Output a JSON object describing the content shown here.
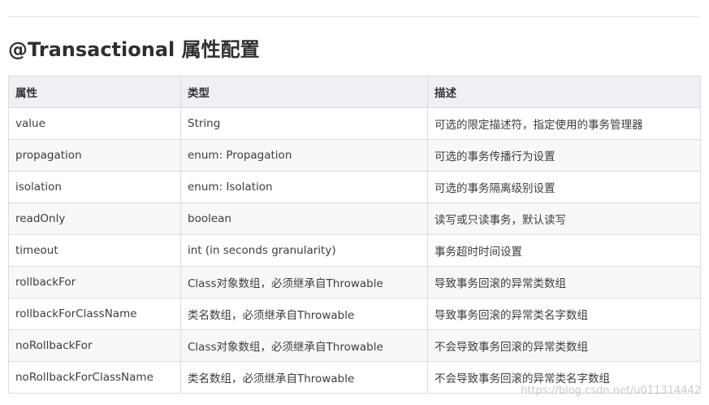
{
  "heading": "@Transactional 属性配置",
  "table": {
    "headers": [
      "属性",
      "类型",
      "描述"
    ],
    "rows": [
      [
        "value",
        "String",
        "可选的限定描述符，指定使用的事务管理器"
      ],
      [
        "propagation",
        "enum: Propagation",
        "可选的事务传播行为设置"
      ],
      [
        "isolation",
        "enum: Isolation",
        "可选的事务隔离级别设置"
      ],
      [
        "readOnly",
        "boolean",
        "读写或只读事务，默认读写"
      ],
      [
        "timeout",
        "int (in seconds granularity)",
        "事务超时时间设置"
      ],
      [
        "rollbackFor",
        "Class对象数组，必须继承自Throwable",
        "导致事务回滚的异常类数组"
      ],
      [
        "rollbackForClassName",
        "类名数组，必须继承自Throwable",
        "导致事务回滚的异常类名字数组"
      ],
      [
        "noRollbackFor",
        "Class对象数组，必须继承自Throwable",
        "不会导致事务回滚的异常类数组"
      ],
      [
        "noRollbackForClassName",
        "类名数组，必须继承自Throwable",
        "不会导致事务回滚的异常类名字数组"
      ]
    ]
  },
  "watermark": "https://blog.csdn.net/u011314442",
  "colors": {
    "header_bg": "#eef0f3",
    "border": "#dcdcdc",
    "stripe": "#f8f8f8"
  }
}
